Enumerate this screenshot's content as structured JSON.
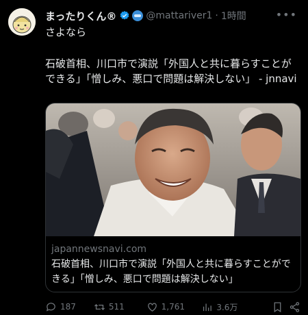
{
  "tweet": {
    "display_name": "まったりくん®",
    "handle": "@mattariver1",
    "separator": "·",
    "time": "1時間",
    "more_label": "•••",
    "text_line1": "さよなら",
    "text_body": "石破首相、川口市で演説「外国人と共に暮らすことができる」「憎しみ、悪口で問題は解決しない」 - jnnavi"
  },
  "card": {
    "domain": "japannewsnavi.com",
    "title": "石破首相、川口市で演説「外国人と共に暮らすことができる」「憎しみ、悪口で問題は解決しない」"
  },
  "actions": {
    "reply_count": "187",
    "retweet_count": "511",
    "like_count": "1,761",
    "views_count": "3.6万"
  },
  "icons": {
    "verified": "verified-badge-icon",
    "affiliate": "affiliate-badge-icon",
    "reply": "reply-icon",
    "retweet": "retweet-icon",
    "like": "heart-icon",
    "views": "views-icon",
    "share": "share-icon"
  },
  "colors": {
    "background": "#000000",
    "text": "#e7e9ea",
    "muted": "#71767b",
    "verified": "#1d9bf0"
  }
}
